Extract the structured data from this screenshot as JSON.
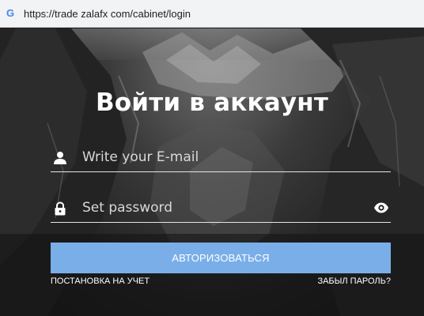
{
  "browser": {
    "url": "https://trade zalafx com/cabinet/login",
    "favicon": "G"
  },
  "login": {
    "title": "Войти в аккаунт",
    "email_placeholder": "Write your E-mail",
    "password_placeholder": "Set password",
    "submit_label": "АВТОРИЗОВАТЬСЯ",
    "register_link": "ПОСТАНОВКА НА УЧЕТ",
    "forgot_link": "ЗАБЫЛ ПАРОЛЬ?"
  },
  "colors": {
    "button": "#7aaee8",
    "text": "#ffffff",
    "underline": "#e6e6e6"
  },
  "icons": {
    "email_icon": "user-icon",
    "password_icon": "lock-icon",
    "toggle_icon": "eye-icon"
  }
}
